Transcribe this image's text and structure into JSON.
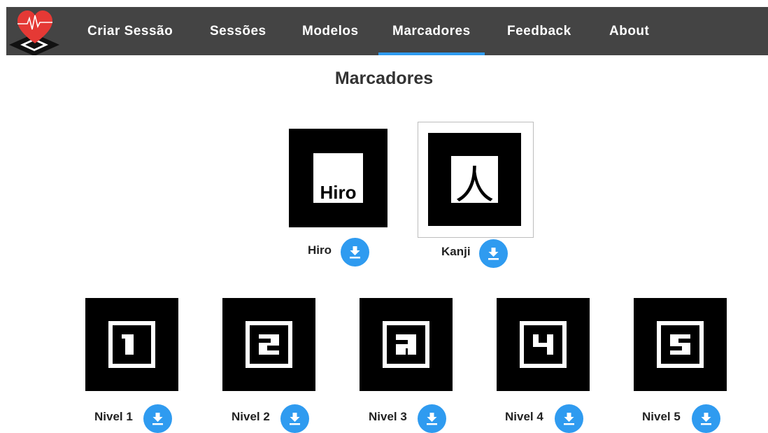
{
  "nav": {
    "logo_icon": "heart-ecg-marker-logo",
    "items": [
      {
        "label": "Criar Sessão"
      },
      {
        "label": "Sessões"
      },
      {
        "label": "Modelos"
      },
      {
        "label": "Marcadores",
        "active": true
      },
      {
        "label": "Feedback"
      },
      {
        "label": "About"
      }
    ],
    "active_indicator_color": "#2f9bf0",
    "background_color": "#444444"
  },
  "page": {
    "title": "Marcadores"
  },
  "markers": [
    {
      "label": "Hiro",
      "symbol": "Hiro"
    },
    {
      "label": "Kanji",
      "symbol": "人"
    },
    {
      "label": "Nivel 1",
      "symbol": "1"
    },
    {
      "label": "Nivel 2",
      "symbol": "2"
    },
    {
      "label": "Nivel 3",
      "symbol": "3"
    },
    {
      "label": "Nivel 4",
      "symbol": "4"
    },
    {
      "label": "Nivel 5",
      "symbol": "5"
    }
  ],
  "download_icon": "download-icon",
  "accent_color": "#2f9bf0"
}
